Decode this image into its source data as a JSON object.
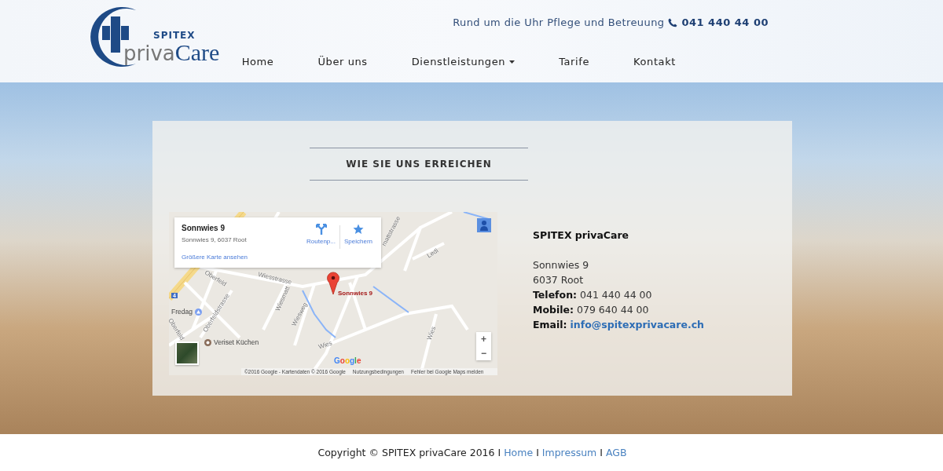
{
  "header": {
    "logo": {
      "top": "SPITEX",
      "name_part_1": "priva",
      "name_part_2": "Care"
    },
    "tagline": "Rund um die Uhr Pflege und Betreuung",
    "phone": "041 440 44 00",
    "nav": [
      {
        "label": "Home",
        "has_submenu": false
      },
      {
        "label": "Über uns",
        "has_submenu": false
      },
      {
        "label": "Dienstleistungen",
        "has_submenu": true
      },
      {
        "label": "Tarife",
        "has_submenu": false
      },
      {
        "label": "Kontakt",
        "has_submenu": false
      }
    ]
  },
  "section": {
    "title": "WIE SIE UNS ERREICHEN"
  },
  "map": {
    "card": {
      "title": "Sonnwies 9",
      "address": "Sonnwies 9, 6037 Root",
      "link": "Größere Karte ansehen",
      "actions": [
        {
          "kind": "directions",
          "label": "Routenp..."
        },
        {
          "kind": "save",
          "label": "Speichern"
        }
      ]
    },
    "pin_label": "Sonnwies 9",
    "street_labels": [
      "Wiesstrasse",
      "Oberfeld",
      "Oberfeldstrasse",
      "Wiesmatt",
      "Wiesweg",
      "Wies",
      "Wies",
      "Ledi",
      "mattstrasse",
      "Oberfeld"
    ],
    "road_sign": "4",
    "places": [
      {
        "name": "Fredag",
        "kind": "poi"
      },
      {
        "name": "Veriset Küchen",
        "kind": "shop"
      }
    ],
    "zoom": {
      "in": "+",
      "out": "−"
    },
    "brand": "Google",
    "attribution": [
      "©2016 Google - Kartendaten © 2016 Google",
      "Nutzungsbedingungen",
      "Fehler bei Google Maps melden"
    ]
  },
  "contact": {
    "name": "SPITEX privaCare",
    "address": [
      "Sonnwies 9",
      "6037 Root"
    ],
    "details": [
      {
        "label": "Telefon:",
        "value": "041 440 44 00",
        "kind": "text"
      },
      {
        "label": "Mobile:",
        "value": "079 640 44 00",
        "kind": "text"
      },
      {
        "label": "Email:",
        "value": "info@spitexprivacare.ch",
        "kind": "link"
      }
    ]
  },
  "footer": {
    "copyright": "Copyright © SPITEX privaCare 2016",
    "links": [
      {
        "separator": "I",
        "label": "Home"
      },
      {
        "separator": "I",
        "label": "Impressum"
      },
      {
        "separator": "I",
        "label": "AGB"
      }
    ]
  }
}
